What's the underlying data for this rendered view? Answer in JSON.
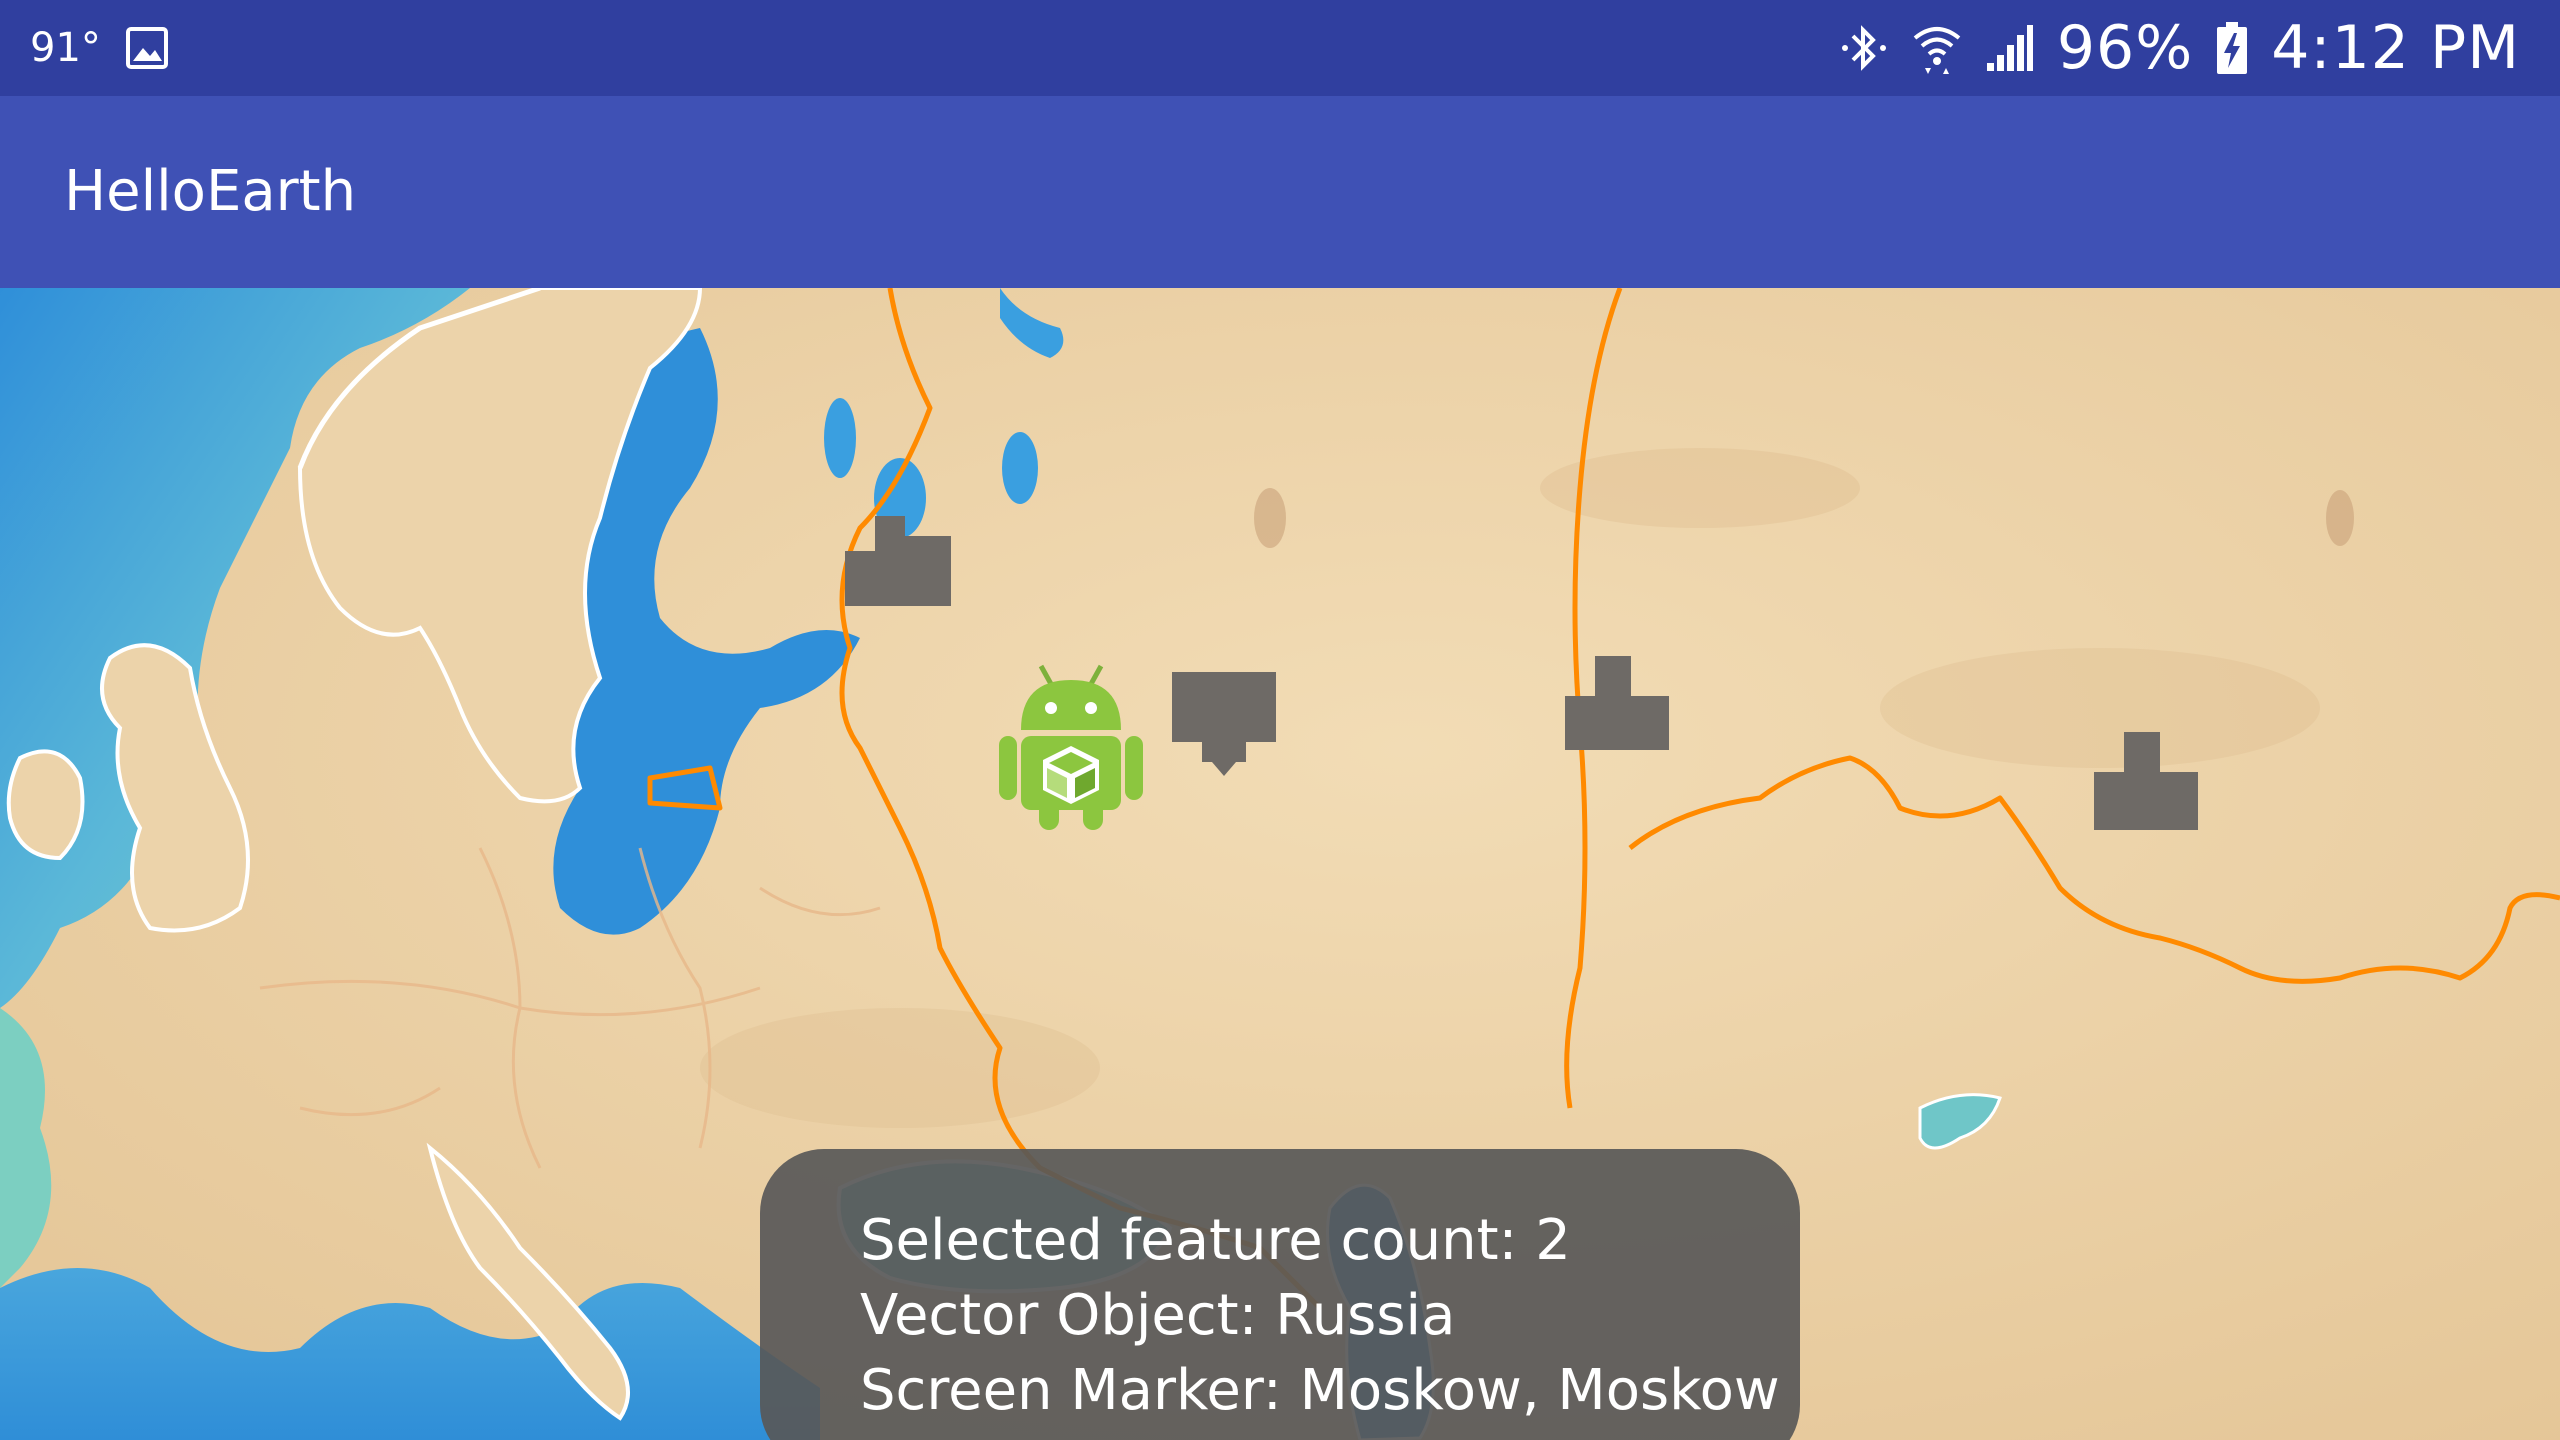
{
  "status_bar": {
    "temperature": "91°",
    "battery": "96%",
    "time": "4:12 PM",
    "icons": [
      "image-icon",
      "bluetooth-icon",
      "wifi-icon",
      "signal-icon",
      "battery-charging-icon"
    ]
  },
  "app_bar": {
    "title": "HelloEarth",
    "color": "#3f51b5"
  },
  "map": {
    "style": "watercolor",
    "markers": [
      "building-icon",
      "building-icon",
      "building-icon",
      "building-icon",
      "android-marker-icon"
    ],
    "border_color": "#ff8a00"
  },
  "toast": {
    "lines": [
      "Selected feature count: 2",
      "Vector Object: Russia",
      "Screen Marker: Moskow, Moskow"
    ]
  },
  "colors": {
    "status_bar": "#303f9f",
    "water": "#3a9fe0",
    "land": "#ecd3aa"
  }
}
